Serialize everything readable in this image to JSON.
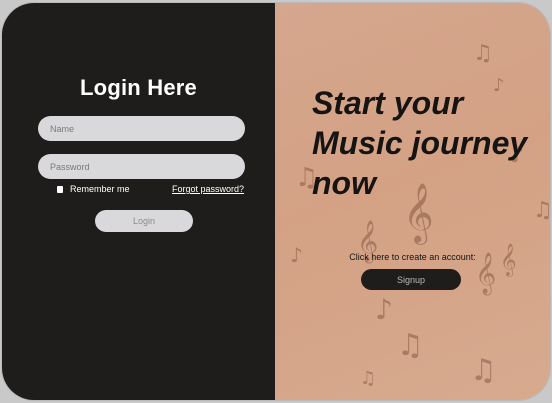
{
  "login": {
    "title": "Login Here",
    "name_placeholder": "Name",
    "password_placeholder": "Password",
    "remember_label": "Remember me",
    "forgot_label": "Forgot password?",
    "login_label": "Login"
  },
  "promo": {
    "headline": "Start your Music journey now",
    "cta_text": "Click here to create an account:",
    "signup_label": "Signup"
  },
  "colors": {
    "left_panel": "#1e1d1b",
    "right_panel": "#d4a184",
    "input_bg": "#d9d9db"
  },
  "decor": {
    "icon": "music-note-icon"
  }
}
